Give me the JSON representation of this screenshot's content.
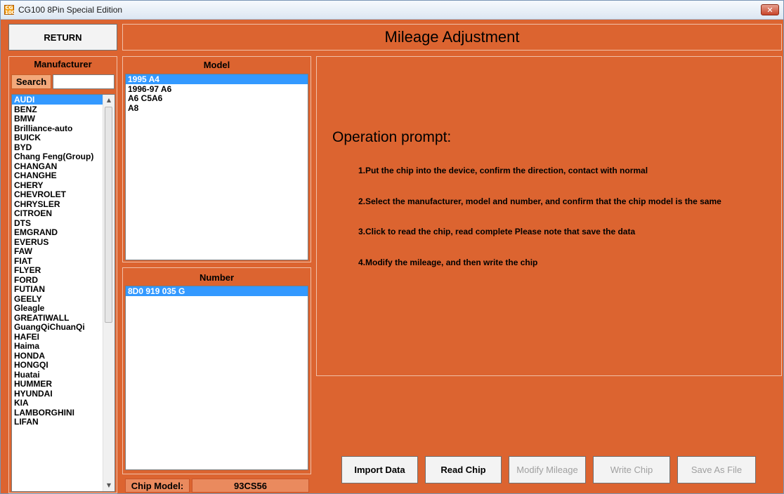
{
  "window": {
    "title": "CG100 8Pin Special Edition",
    "icon_name": "app-icon",
    "icon_text": "CG 100",
    "close_icon": "close-icon"
  },
  "header": {
    "return_label": "RETURN",
    "page_title": "Mileage Adjustment"
  },
  "manufacturer": {
    "heading": "Manufacturer",
    "search_label": "Search",
    "search_value": "",
    "items": [
      "AUDI",
      "BENZ",
      "BMW",
      "Brilliance-auto",
      "BUICK",
      "BYD",
      "Chang Feng(Group)",
      "CHANGAN",
      "CHANGHE",
      "CHERY",
      "CHEVROLET",
      "CHRYSLER",
      "CITROEN",
      "DTS",
      "EMGRAND",
      "EVERUS",
      "FAW",
      "FIAT",
      "FLYER",
      "FORD",
      "FUTIAN",
      "GEELY",
      "Gleagle",
      "GREATIWALL",
      "GuangQiChuanQi",
      "HAFEI",
      "Haima",
      "HONDA",
      "HONGQI",
      "Huatai",
      "HUMMER",
      "HYUNDAI",
      "KIA",
      "LAMBORGHINI",
      "LIFAN"
    ],
    "selected": "AUDI"
  },
  "model": {
    "heading": "Model",
    "items": [
      "1995 A4",
      "1996-97 A6",
      "A6 C5A6",
      "A8"
    ],
    "selected": "1995 A4"
  },
  "number": {
    "heading": "Number",
    "items": [
      "8D0 919 035 G"
    ],
    "selected": "8D0 919 035 G"
  },
  "chip": {
    "label": "Chip Model:",
    "value": "93CS56"
  },
  "prompt": {
    "title": "Operation prompt:",
    "steps": [
      "1.Put the chip into the device, confirm the direction, contact with normal",
      "2.Select the manufacturer, model and number, and confirm that the chip model is the same",
      "3.Click to read the chip, read complete Please note that save the data",
      "4.Modify the mileage, and then write the chip"
    ]
  },
  "actions": {
    "import_data": "Import Data",
    "read_chip": "Read Chip",
    "modify_mileage": "Modify Mileage",
    "write_chip": "Write Chip",
    "save_as_file": "Save As File"
  },
  "colors": {
    "background": "#dc6430",
    "selection": "#3399ff",
    "frame_border": "#f0c0a8"
  }
}
